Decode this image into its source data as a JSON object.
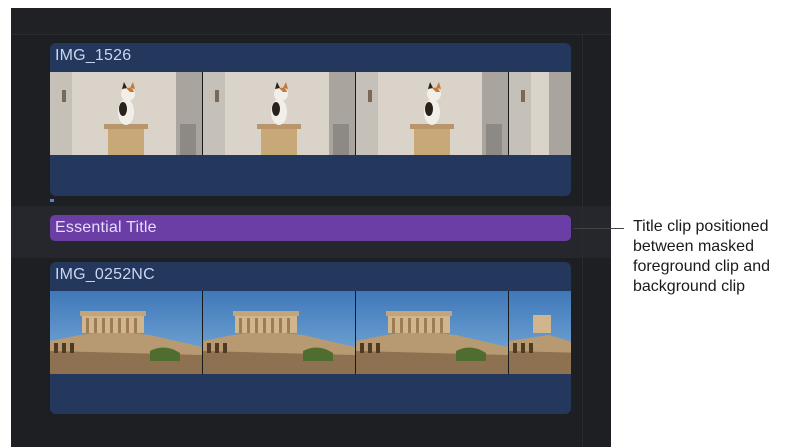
{
  "timeline": {
    "upper_clip": {
      "name": "IMG_1526",
      "thumbnail": "cat-on-stand"
    },
    "title_clip": {
      "name": "Essential Title"
    },
    "lower_clip": {
      "name": "IMG_0252NC",
      "thumbnail": "acropolis-ruins"
    }
  },
  "callout": {
    "text": "Title clip positioned between masked foreground clip and background clip"
  },
  "colors": {
    "timeline_bg": "#1e1f23",
    "clip_bg": "#24375c",
    "title_clip_bg": "#6b3ea6",
    "clip_label": "#c8d6f0"
  }
}
